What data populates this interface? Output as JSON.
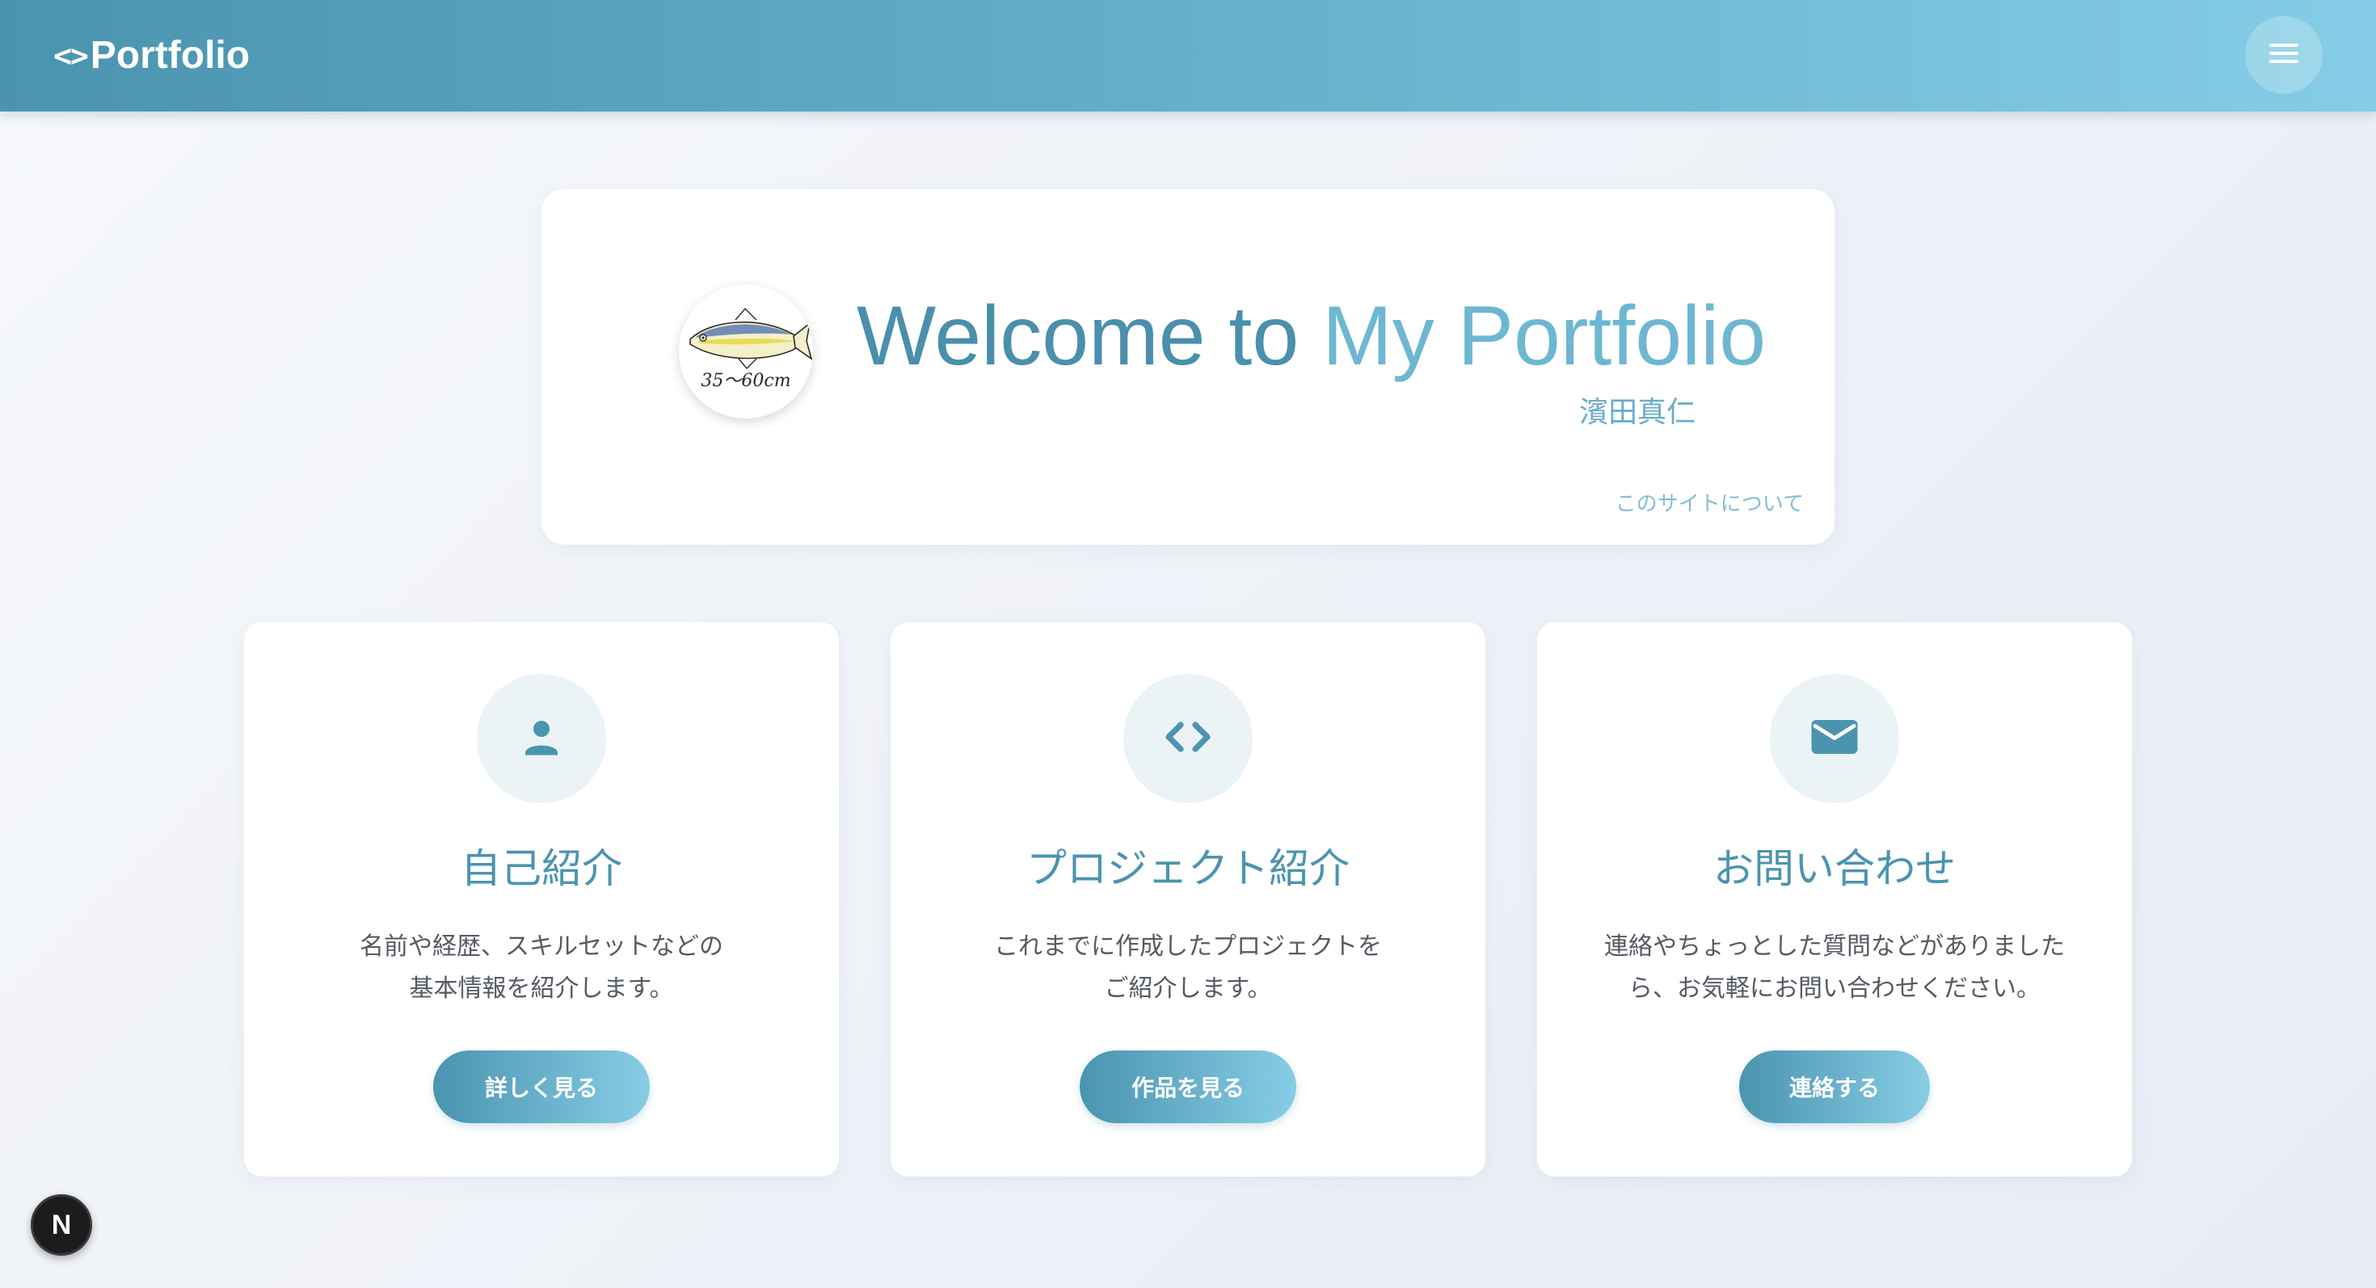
{
  "header": {
    "logo_icon": "<>",
    "logo_text": "Portfolio",
    "menu_icon": "hamburger-menu-icon"
  },
  "hero": {
    "title_part1": "Welcome to ",
    "title_part2": "My Portfolio",
    "subtitle": "濱田真仁",
    "about_link": "このサイトについて",
    "avatar_caption": "35〜60cm"
  },
  "cards": [
    {
      "icon": "person-icon",
      "title": "自己紹介",
      "desc_line1": "名前や経歴、スキルセットなどの",
      "desc_line2": "基本情報を紹介します。",
      "button": "詳しく見る"
    },
    {
      "icon": "code-icon",
      "title": "プロジェクト紹介",
      "desc_line1": "これまでに作成したプロジェクトを",
      "desc_line2": "ご紹介します。",
      "button": "作品を見る"
    },
    {
      "icon": "mail-icon",
      "title": "お問い合わせ",
      "desc_line1": "連絡やちょっとした質問などがありました",
      "desc_line2": "ら、お気軽にお問い合わせください。",
      "button": "連絡する"
    }
  ],
  "next_badge": {
    "label": "N"
  },
  "colors": {
    "accent": "#4b94b0",
    "accent_light": "#86cde5",
    "card_icon_bg": "#ebf3f6",
    "text_body": "#555b63"
  }
}
